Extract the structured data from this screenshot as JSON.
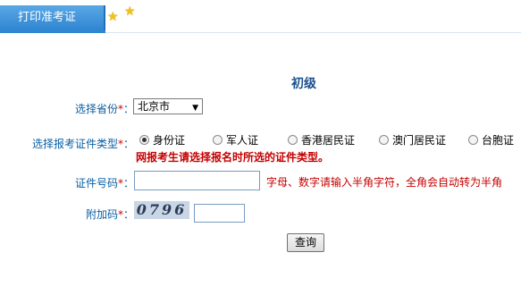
{
  "tab": {
    "label": "打印准考证"
  },
  "title": "初级",
  "form": {
    "province": {
      "label": "选择省份",
      "required_mark": "*",
      "colon": "：",
      "value": "北京市"
    },
    "id_type": {
      "label": "选择报考证件类型",
      "required_mark": "*",
      "colon": "：",
      "options": [
        "身份证",
        "军人证",
        "香港居民证",
        "澳门居民证",
        "台胞证"
      ],
      "selected": "身份证",
      "warning": "网报考生请选择报名时所选的证件类型。"
    },
    "id_number": {
      "label": "证件号码",
      "required_mark": "*",
      "colon": "：",
      "hint": "字母、数字请输入半角字符，全角会自动转为半角"
    },
    "captcha": {
      "label": "附加码",
      "required_mark": "*",
      "colon": "：",
      "image_text": "0796"
    },
    "submit_label": "查询"
  },
  "colors": {
    "label": "#0a5fa3",
    "required": "#d40000",
    "tab": "#2f86d1",
    "title": "#1b4f8c"
  },
  "icons": [
    "star-icon",
    "star-icon",
    "dropdown-arrow-icon",
    "radio-icon"
  ]
}
